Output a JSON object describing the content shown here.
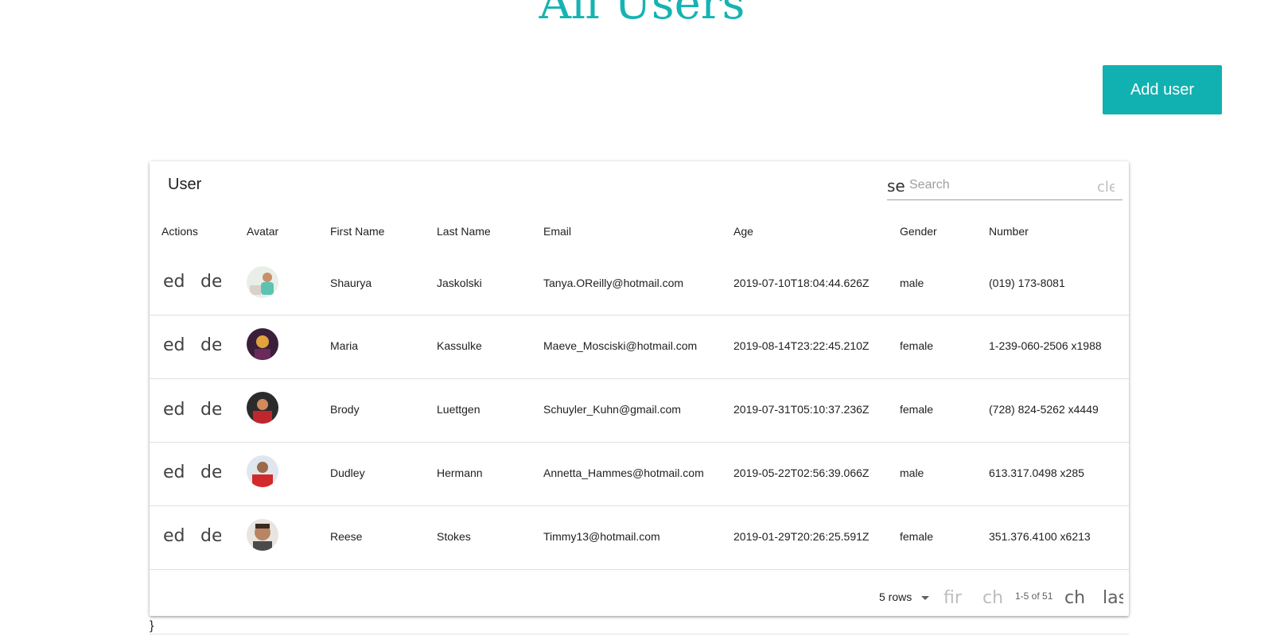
{
  "page": {
    "title": "All Users"
  },
  "add_button": {
    "label": "Add user"
  },
  "table": {
    "title": "User",
    "search": {
      "icon_text": "se",
      "placeholder": "Search",
      "value": "",
      "clear_text": "cle",
      "icon": "search-icon",
      "clear_icon": "clear-icon"
    },
    "columns": [
      "Actions",
      "Avatar",
      "First Name",
      "Last Name",
      "Email",
      "Age",
      "Gender",
      "Number"
    ],
    "rows": [
      {
        "edit": "ed",
        "delete": "de",
        "first": "Shaurya",
        "last": "Jaskolski",
        "email": "Tanya.OReilly@hotmail.com",
        "age": "2019-07-10T18:04:44.626Z",
        "gender": "male",
        "number": "(019) 173-8081"
      },
      {
        "edit": "ed",
        "delete": "de",
        "first": "Maria",
        "last": "Kassulke",
        "email": "Maeve_Mosciski@hotmail.com",
        "age": "2019-08-14T23:22:45.210Z",
        "gender": "female",
        "number": "1-239-060-2506 x1988"
      },
      {
        "edit": "ed",
        "delete": "de",
        "first": "Brody",
        "last": "Luettgen",
        "email": "Schuyler_Kuhn@gmail.com",
        "age": "2019-07-31T05:10:37.236Z",
        "gender": "female",
        "number": "(728) 824-5262 x4449"
      },
      {
        "edit": "ed",
        "delete": "de",
        "first": "Dudley",
        "last": "Hermann",
        "email": "Annetta_Hammes@hotmail.com",
        "age": "2019-05-22T02:56:39.066Z",
        "gender": "male",
        "number": "613.317.0498 x285"
      },
      {
        "edit": "ed",
        "delete": "de",
        "first": "Reese",
        "last": "Stokes",
        "email": "Timmy13@hotmail.com",
        "age": "2019-01-29T20:26:25.591Z",
        "gender": "female",
        "number": "351.376.4100 x6213"
      }
    ],
    "pagination": {
      "rows_label": "5 rows",
      "first": "fir",
      "prev": "ch",
      "info": "1-5 of 51",
      "next": "ch",
      "last": "las"
    }
  },
  "trailing_text": "}",
  "colors": {
    "accent": "#12b1b1",
    "title": "#15b3b3"
  }
}
